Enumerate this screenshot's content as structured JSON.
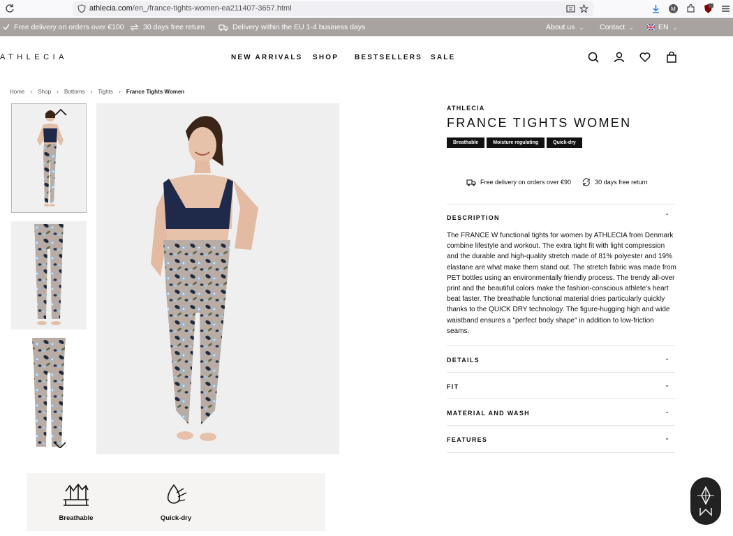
{
  "browser": {
    "url_domain": "athlecia.com",
    "url_path": "/en_/france-tights-women-ea211407-3657.html",
    "icons": [
      "reload-icon",
      "shield-icon",
      "reader-icon",
      "bookmark-star-icon",
      "download-icon",
      "profile-icon",
      "extensions-icon",
      "ublock-icon"
    ]
  },
  "promo": {
    "free_delivery": "Free delivery on orders over €100",
    "free_return": "30 days free return",
    "eu_delivery": "Delivery within the EU 1-4 business days",
    "about": "About us",
    "contact": "Contact",
    "language": "EN"
  },
  "header": {
    "logo": "ATHLECIA",
    "nav": [
      "NEW ARRIVALS",
      "SHOP",
      "BESTSELLERS",
      "SALE"
    ],
    "icons": [
      "search-icon",
      "account-icon",
      "wishlist-heart-icon",
      "cart-bag-icon"
    ]
  },
  "breadcrumb": [
    "Home",
    "Shop",
    "Bottoms",
    "Tights",
    "France Tights Women"
  ],
  "product": {
    "brand": "ATHLECIA",
    "title": "FRANCE TIGHTS WOMEN",
    "badges": [
      "Breathable",
      "Moisture regulating",
      "Quick-dry"
    ],
    "delivery_note": "Free delivery on orders over €90",
    "return_note": "30 days free return",
    "accordion": [
      "DESCRIPTION",
      "DETAILS",
      "FIT",
      "MATERIAL AND WASH",
      "FEATURES"
    ],
    "description": "The FRANCE W functional tights for women by ATHLECIA from Denmark combine lifestyle and workout. The extra tight fit with light compression and the durable and high-quality stretch made of 81% polyester and 19% elastane are what make them stand out. The stretch fabric was made from PET bottles using an environmentally friendly process. The trendy all-over print and the beautiful colors make the fashion-conscious athlete's heart beat faster. The breathable functional material dries particularly quickly thanks to the QUICK DRY technology. The figure-hugging high and wide waistband ensures a \"perfect body shape\" in addition to low-friction seams."
  },
  "features": [
    "Breathable",
    "Quick-dry"
  ],
  "colors": {
    "promo_bg": "#a8a3a0",
    "badge_bg": "#111111",
    "tights_base": "#b9aca4",
    "bra_navy": "#1f2a4a"
  }
}
